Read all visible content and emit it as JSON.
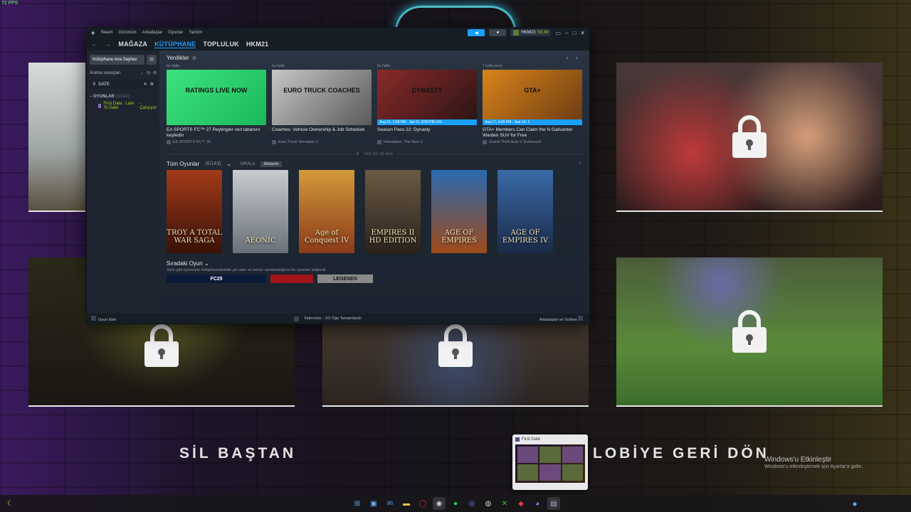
{
  "overlay": {
    "fps": "72 FPS",
    "restart_label": "SİL BAŞTAN",
    "lobby_label": "LOBİYE GERİ DÖN"
  },
  "steam": {
    "titlebar": {
      "menu": [
        "Steam",
        "Görünüm",
        "Arkadaşlar",
        "Oyunlar",
        "Yardım"
      ],
      "username": "HKM23",
      "wallet": "50,39"
    },
    "nav": {
      "tabs": [
        "MAĞAZA",
        "KÜTÜPHANE",
        "TOPLULUK",
        "HKM21"
      ],
      "active_tab": "KÜTÜPHANE"
    },
    "sidebar": {
      "home_label": "Kütüphane Ana Sayfası",
      "filter_label": "Arama sonuçları",
      "search_value": "DATE",
      "category_label": "OYUNLAR",
      "category_count": "(1/143)",
      "game_name": "First Date : Late To Date",
      "game_status": "- Çalışıyor"
    },
    "news": {
      "title": "Yenilikler",
      "cards": [
        {
          "when": "bu hafta",
          "thumb_text": "RATINGS LIVE NOW",
          "badge": "",
          "headline": "EA SPORTS FC™ 27 Reytingler veri tabanını keşfedin",
          "source": "EA SPORTS FC™ 26",
          "c1": "#3de37f",
          "c2": "#1bb85a"
        },
        {
          "when": "bu hafta",
          "thumb_text": "EURO TRUCK COACHES",
          "badge": "",
          "headline": "Coaches: Vehicle Ownership & Job Schedule",
          "source": "Euro Truck Simulator 2",
          "c1": "#c7c7c7",
          "c2": "#5a5a5a"
        },
        {
          "when": "bu hafta",
          "thumb_text": "DYNASTY",
          "badge": "Aug 21, 3:59 PM - Jan 11, 8:00 PM +03",
          "headline": "Season Pass 22: Dynasty",
          "source": "Infestation: The New Z",
          "c1": "#8a2a2a",
          "c2": "#2a1414"
        },
        {
          "when": "1 hafta önce",
          "thumb_text": "GTA+",
          "badge": "Aug 17, 4:45 PM - Sep 10, 1:",
          "headline": "GTA+ Members Can Claim the N Galivanter Warden SUV for Free",
          "source": "Grand Theft Auto V Enhanced",
          "c1": "#d8841a",
          "c2": "#6a3a12"
        }
      ]
    },
    "shelf_add": "Yeni bir raf ekle",
    "all_games": {
      "title": "Tüm Oyunlar",
      "count": "(6/143)",
      "sort_label": "SIRALA",
      "sort_value": "Alfabetik",
      "covers": [
        {
          "text": "TROY A TOTAL WAR SAGA",
          "c1": "#a23a1a",
          "c2": "#3a1208"
        },
        {
          "text": "AEONIC",
          "c1": "#c8ccd0",
          "c2": "#6a7078"
        },
        {
          "text": "Age of Conquest IV",
          "c1": "#d49a3a",
          "c2": "#8a3a1a"
        },
        {
          "text": "EMPIRES II HD EDITION",
          "c1": "#6a5a44",
          "c2": "#2a221a"
        },
        {
          "text": "AGE OF EMPIRES",
          "c1": "#2a6ab0",
          "c2": "#a04a1a"
        },
        {
          "text": "AGE OF EMPIRES IV",
          "c1": "#3a6aa8",
          "c2": "#1a2a48"
        }
      ]
    },
    "up_next": {
      "title": "Sıradaki Oyun",
      "subtitle": "Sizin gibi oyuncular kütüphanelerinde yer alan ve henüz oynamadığınız bu oyunları beğendi",
      "items": [
        "FC25",
        "",
        "LEGENDS"
      ]
    },
    "statusbar": {
      "add_game": "Oyun Ekle",
      "downloads": "İndirmeler - 2/2 Öğe Tamamlandı",
      "friends": "Arkadaşlar ve Sohbet"
    }
  },
  "preview": {
    "title": "First Date"
  },
  "activation": {
    "title": "Windows'u Etkinleştir",
    "subtitle": "Windows'u etkinleştirmek için Ayarlar'a gidin."
  },
  "taskbar": {
    "icons": [
      "windows-icon",
      "explorer-icon",
      "mail-icon",
      "folder-icon",
      "opera-icon",
      "steam-icon",
      "spotify-icon",
      "app-icon",
      "chrome-icon",
      "xbox-icon",
      "cast-icon",
      "discord-icon",
      "first-date-icon"
    ]
  }
}
